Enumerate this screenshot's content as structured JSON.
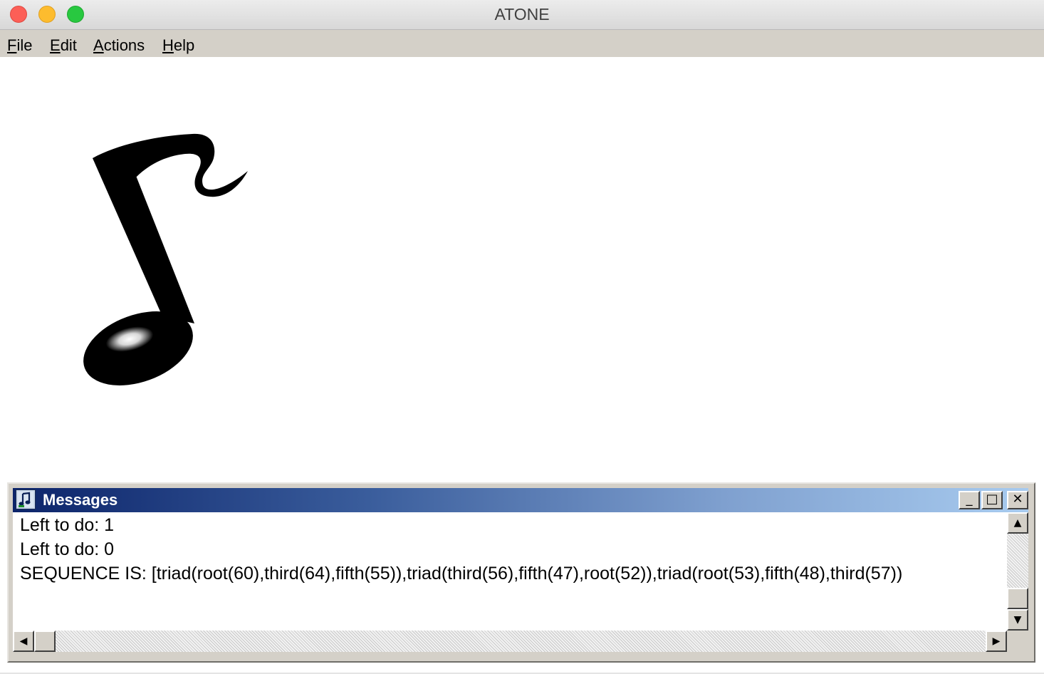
{
  "window": {
    "title": "ATONE"
  },
  "menu": {
    "items": [
      {
        "acc": "F",
        "rest": "ile"
      },
      {
        "acc": "E",
        "rest": "dit"
      },
      {
        "acc": "A",
        "rest": "ctions"
      },
      {
        "acc": "H",
        "rest": "elp"
      }
    ]
  },
  "canvas": {
    "image": "music-note-icon"
  },
  "messages": {
    "title": "Messages",
    "lines": [
      "Left to do:  1",
      "Left to do:  0",
      "SEQUENCE IS: [triad(root(60),third(64),fifth(55)),triad(third(56),fifth(47),root(52)),triad(root(53),fifth(48),third(57))"
    ],
    "buttons": {
      "minimize": "_",
      "maximize": "□",
      "close": "✕"
    },
    "scroll_up": "▲",
    "scroll_down": "▼",
    "scroll_left": "◀",
    "scroll_right": "▶"
  }
}
